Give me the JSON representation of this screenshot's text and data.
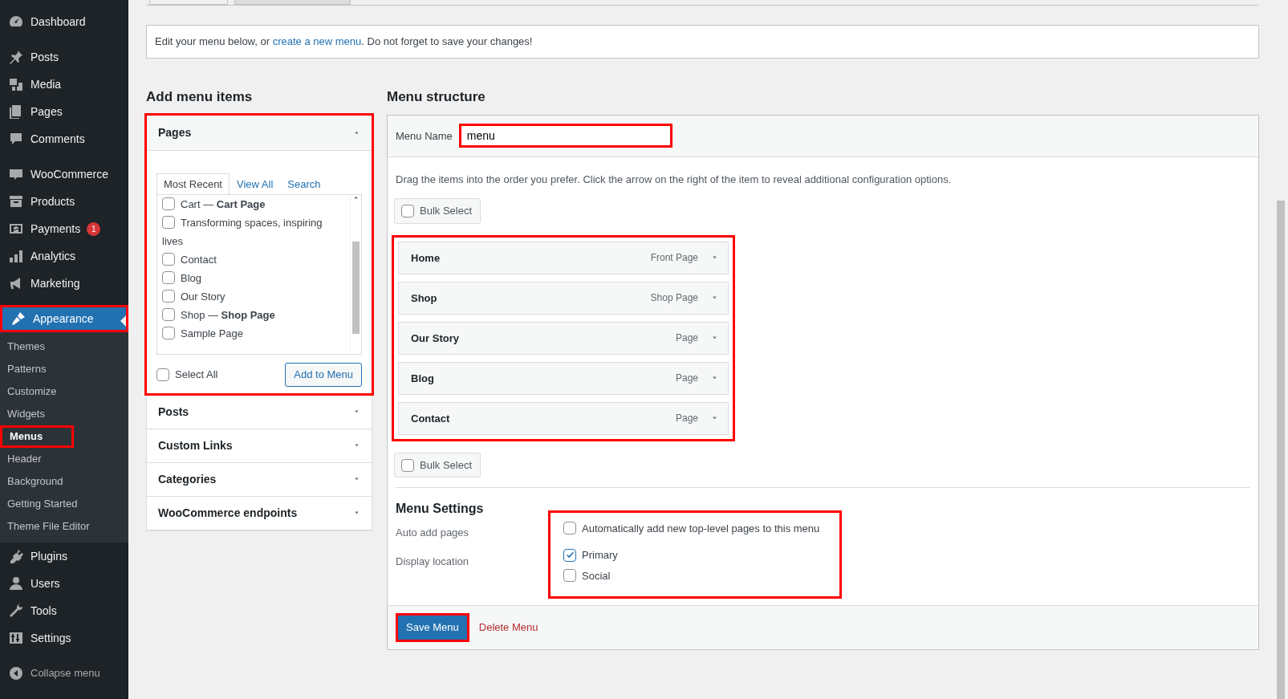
{
  "sidebar": {
    "groups": [
      [
        {
          "label": "Dashboard",
          "selected": false,
          "highlighted": false
        }
      ],
      [
        {
          "label": "Posts",
          "selected": false,
          "highlighted": false
        },
        {
          "label": "Media",
          "selected": false,
          "highlighted": false
        },
        {
          "label": "Pages",
          "selected": false,
          "highlighted": false
        },
        {
          "label": "Comments",
          "selected": false,
          "highlighted": false
        }
      ],
      [
        {
          "label": "WooCommerce",
          "selected": false,
          "highlighted": false
        },
        {
          "label": "Products",
          "selected": false,
          "highlighted": false
        },
        {
          "label": "Payments",
          "badge": "1",
          "selected": false,
          "highlighted": false
        },
        {
          "label": "Analytics",
          "selected": false,
          "highlighted": false
        },
        {
          "label": "Marketing",
          "selected": false,
          "highlighted": false
        }
      ],
      [
        {
          "label": "Appearance",
          "selected": true,
          "highlighted": true,
          "children": [
            {
              "label": "Themes",
              "selected": false,
              "highlighted": false
            },
            {
              "label": "Patterns",
              "selected": false,
              "highlighted": false
            },
            {
              "label": "Customize",
              "selected": false,
              "highlighted": false
            },
            {
              "label": "Widgets",
              "selected": false,
              "highlighted": false
            },
            {
              "label": "Menus",
              "selected": true,
              "highlighted": true
            },
            {
              "label": "Header",
              "selected": false,
              "highlighted": false
            },
            {
              "label": "Background",
              "selected": false,
              "highlighted": false
            },
            {
              "label": "Getting Started",
              "selected": false,
              "highlighted": false
            },
            {
              "label": "Theme File Editor",
              "selected": false,
              "highlighted": false
            }
          ]
        },
        {
          "label": "Plugins",
          "selected": false,
          "highlighted": false
        },
        {
          "label": "Users",
          "selected": false,
          "highlighted": false
        },
        {
          "label": "Tools",
          "selected": false,
          "highlighted": false
        },
        {
          "label": "Settings",
          "selected": false,
          "highlighted": false
        }
      ]
    ],
    "collapse": "Collapse menu"
  },
  "notice": {
    "before": "Edit your menu below, or ",
    "link": "create a new menu",
    "after": ". Do not forget to save your changes!"
  },
  "add_items": {
    "heading": "Add menu items",
    "sections": [
      {
        "title": "Pages",
        "expanded": true,
        "highlighted": true
      },
      {
        "title": "Posts",
        "expanded": false,
        "highlighted": false
      },
      {
        "title": "Custom Links",
        "expanded": false,
        "highlighted": false
      },
      {
        "title": "Categories",
        "expanded": false,
        "highlighted": false
      },
      {
        "title": "WooCommerce endpoints",
        "expanded": false,
        "highlighted": false
      }
    ],
    "tabs": [
      {
        "label": "Most Recent",
        "selected": true
      },
      {
        "label": "View All",
        "selected": false
      },
      {
        "label": "Search",
        "selected": false
      }
    ],
    "pages": [
      {
        "label": "Cart — **Cart Page**",
        "checked": false
      },
      {
        "label": "Transforming spaces, inspiring lives",
        "checked": false
      },
      {
        "label": "Contact",
        "checked": false
      },
      {
        "label": "Blog",
        "checked": false
      },
      {
        "label": "Our Story",
        "checked": false
      },
      {
        "label": "Shop — **Shop Page**",
        "checked": false
      },
      {
        "label": "Sample Page",
        "checked": false
      }
    ],
    "select_all": {
      "label": "Select All",
      "checked": false
    },
    "add_button": "Add to Menu"
  },
  "structure": {
    "heading": "Menu structure",
    "menu_name": {
      "label": "Menu Name",
      "value": "menu",
      "highlighted": true
    },
    "instructions": "Drag the items into the order you prefer. Click the arrow on the right of the item to reveal additional configuration options.",
    "bulk_top": {
      "label": "Bulk Select",
      "checked": false
    },
    "items_highlighted": true,
    "items": [
      {
        "title": "Home",
        "type": "Front Page"
      },
      {
        "title": "Shop",
        "type": "Shop Page"
      },
      {
        "title": "Our Story",
        "type": "Page"
      },
      {
        "title": "Blog",
        "type": "Page"
      },
      {
        "title": "Contact",
        "type": "Page"
      }
    ],
    "bulk_bottom": {
      "label": "Bulk Select",
      "checked": false
    },
    "settings": {
      "heading": "Menu Settings",
      "highlighted": true,
      "auto_add": {
        "label": "Auto add pages",
        "option": {
          "label": "Automatically add new top-level pages to this menu",
          "checked": false
        }
      },
      "display_location": {
        "label": "Display location",
        "options": [
          {
            "label": "Primary",
            "checked": true
          },
          {
            "label": "Social",
            "checked": false
          }
        ]
      }
    },
    "save_button": {
      "label": "Save Menu",
      "highlighted": true
    },
    "delete_link": "Delete Menu"
  }
}
